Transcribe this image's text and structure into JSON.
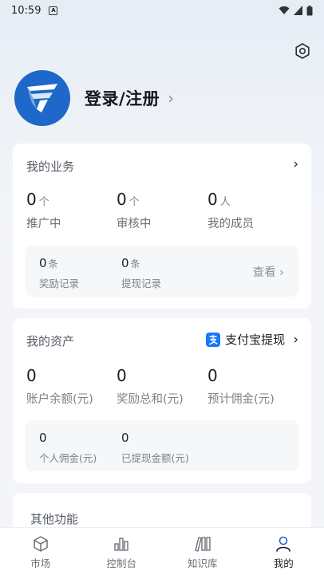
{
  "status_bar": {
    "time": "10:59",
    "notif_glyph": "A"
  },
  "settings": {
    "icon": "gear-icon"
  },
  "profile": {
    "login_label": "登录/注册",
    "chevron": "›"
  },
  "business": {
    "title": "我的业务",
    "chevron": "›",
    "stats": [
      {
        "value": "0",
        "unit": "个",
        "label": "推广中"
      },
      {
        "value": "0",
        "unit": "个",
        "label": "审核中"
      },
      {
        "value": "0",
        "unit": "人",
        "label": "我的成员"
      }
    ],
    "records": [
      {
        "value": "0",
        "unit": "条",
        "label": "奖励记录"
      },
      {
        "value": "0",
        "unit": "条",
        "label": "提现记录"
      }
    ],
    "view_label": "查看 ›"
  },
  "assets": {
    "title": "我的资产",
    "alipay_label": "支付宝提现",
    "chevron": "›",
    "stats": [
      {
        "value": "0",
        "label": "账户余额(元)"
      },
      {
        "value": "0",
        "label": "奖励总和(元)"
      },
      {
        "value": "0",
        "label": "预计佣金(元)"
      }
    ],
    "sub": [
      {
        "value": "0",
        "label": "个人佣金(元)"
      },
      {
        "value": "0",
        "label": "已提现金额(元)"
      }
    ]
  },
  "other": {
    "title": "其他功能"
  },
  "tabbar": {
    "items": [
      {
        "label": "市场",
        "icon": "cube-icon"
      },
      {
        "label": "控制台",
        "icon": "bar-chart-icon"
      },
      {
        "label": "知识库",
        "icon": "books-icon"
      },
      {
        "label": "我的",
        "icon": "person-icon",
        "active": true
      }
    ]
  },
  "colors": {
    "accent": "#1d68c8",
    "alipay": "#1677ff"
  }
}
